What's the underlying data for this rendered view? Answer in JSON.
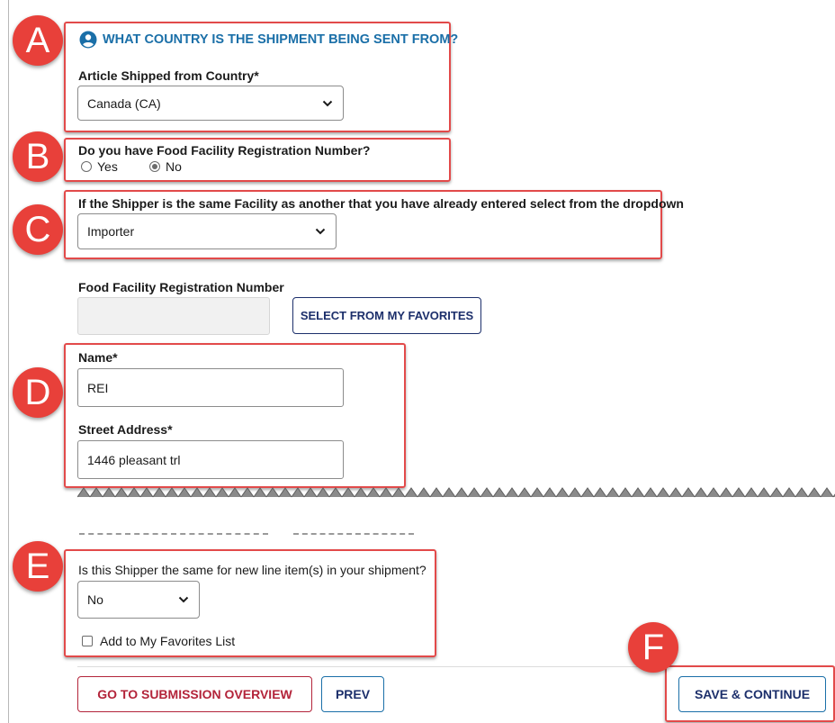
{
  "callouts": {
    "a": "A",
    "b": "B",
    "c": "C",
    "d": "D",
    "e": "E",
    "f": "F"
  },
  "section_a": {
    "heading": "WHAT COUNTRY IS THE SHIPMENT BEING SENT FROM?",
    "heading_icon": "user-circle-icon",
    "country_label": "Article Shipped from Country*",
    "country_value": "Canada (CA)"
  },
  "section_b": {
    "question": "Do you have Food Facility Registration Number?",
    "yes_label": "Yes",
    "no_label": "No",
    "selected": "No"
  },
  "section_c": {
    "question": "If the Shipper is the same Facility as another that you have already entered select from the dropdown",
    "value": "Importer"
  },
  "ffr": {
    "label": "Food Facility Registration Number",
    "value": "",
    "favorites_button": "SELECT FROM MY FAVORITES"
  },
  "section_d": {
    "name_label": "Name*",
    "name_value": "REI",
    "street_label": "Street Address*",
    "street_value": "1446 pleasant trl"
  },
  "section_e": {
    "question": "Is this Shipper the same for new line item(s) in your shipment?",
    "value": "No",
    "favorites_checkbox_label": "Add to My Favorites List",
    "favorites_checked": false
  },
  "footer": {
    "overview_button": "GO TO SUBMISSION OVERVIEW",
    "prev_button": "PREV",
    "save_button": "SAVE & CONTINUE"
  },
  "colors": {
    "heading_blue": "#1a6fa8",
    "callout_red": "#e8403a",
    "overview_red": "#b3243a",
    "navy": "#1c2f6b"
  }
}
